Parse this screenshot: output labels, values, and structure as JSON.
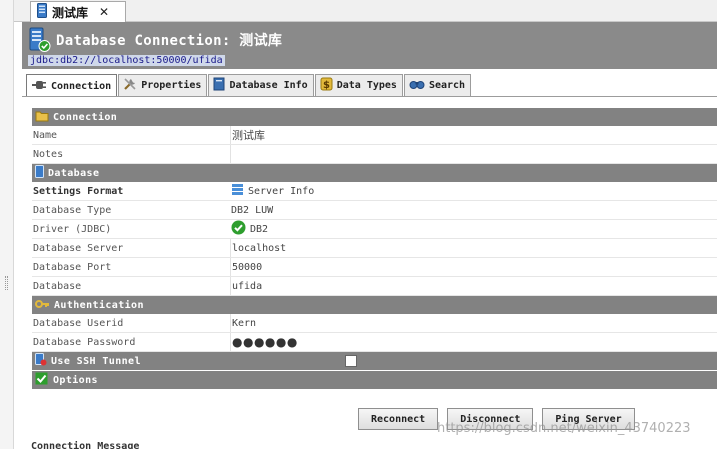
{
  "editor_tab": {
    "label": "测试库",
    "close": "✕"
  },
  "header": {
    "title": "Database Connection: 测试库",
    "url": "jdbc:db2://localhost:50000/ufida"
  },
  "tabs": [
    {
      "label": "Connection",
      "icon": "plug-icon",
      "active": true
    },
    {
      "label": "Properties",
      "icon": "tools-icon",
      "active": false
    },
    {
      "label": "Database Info",
      "icon": "book-icon",
      "active": false
    },
    {
      "label": "Data Types",
      "icon": "dollar-icon",
      "active": false
    },
    {
      "label": "Search",
      "icon": "binoculars-icon",
      "active": false
    }
  ],
  "sections": {
    "connection": "Connection",
    "database": "Database",
    "authentication": "Authentication",
    "ssh": "Use SSH Tunnel",
    "options": "Options"
  },
  "fields": {
    "name": {
      "label": "Name",
      "value": "测试库"
    },
    "notes": {
      "label": "Notes",
      "value": ""
    },
    "settings_format": {
      "label": "Settings Format",
      "value": "Server Info"
    },
    "database_type": {
      "label": "Database Type",
      "value": "DB2 LUW"
    },
    "driver": {
      "label": "Driver (JDBC)",
      "value": "DB2"
    },
    "database_server": {
      "label": "Database Server",
      "value": "localhost"
    },
    "database_port": {
      "label": "Database Port",
      "value": "50000"
    },
    "database": {
      "label": "Database",
      "value": "ufida"
    },
    "userid": {
      "label": "Database Userid",
      "value": "Kern"
    },
    "password": {
      "label": "Database Password",
      "value": "●●●●●●"
    }
  },
  "ssh_checked": false,
  "buttons": {
    "reconnect": "Reconnect",
    "disconnect": "Disconnect",
    "ping": "Ping Server"
  },
  "bottom_label": "Connection Message",
  "watermark": "https://blog.csdn.net/weixin_43740223",
  "colors": {
    "section": "#828282",
    "header": "#8a8a8a",
    "accent_green": "#2e9e2e",
    "icon_blue": "#3a7bc8",
    "icon_gold": "#e2b93b"
  }
}
